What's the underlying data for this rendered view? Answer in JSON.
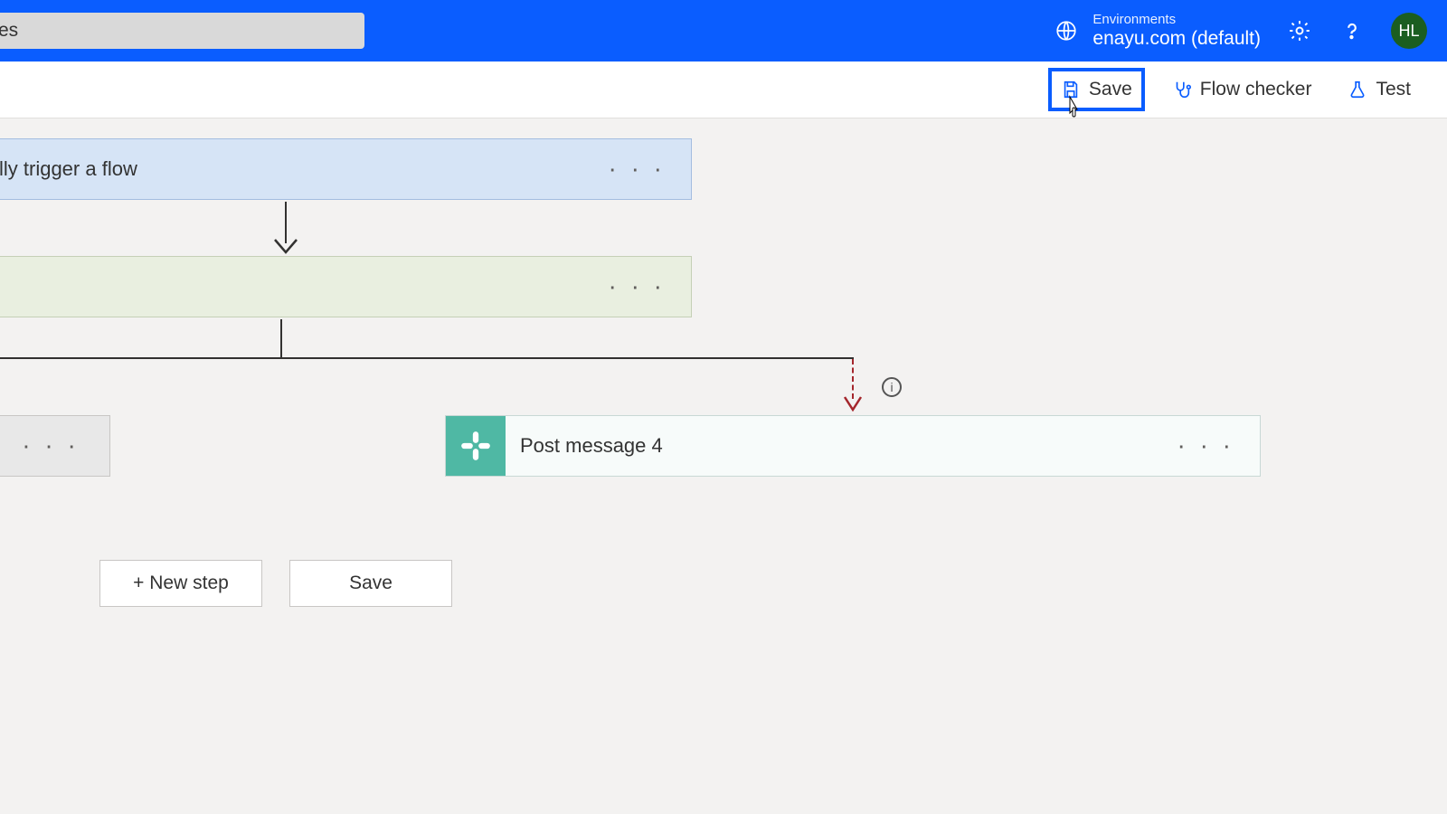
{
  "header": {
    "search_value": "es",
    "env_label": "Environments",
    "env_value": "enayu.com (default)",
    "avatar": "HL"
  },
  "toolbar": {
    "save": "Save",
    "checker": "Flow checker",
    "test": "Test"
  },
  "flow": {
    "trigger_label": "lly trigger a flow",
    "post_card_title": "Post message 4"
  },
  "buttons": {
    "new_step": "+ New step",
    "save": "Save"
  },
  "info_glyph": "i",
  "dots": "· · ·"
}
